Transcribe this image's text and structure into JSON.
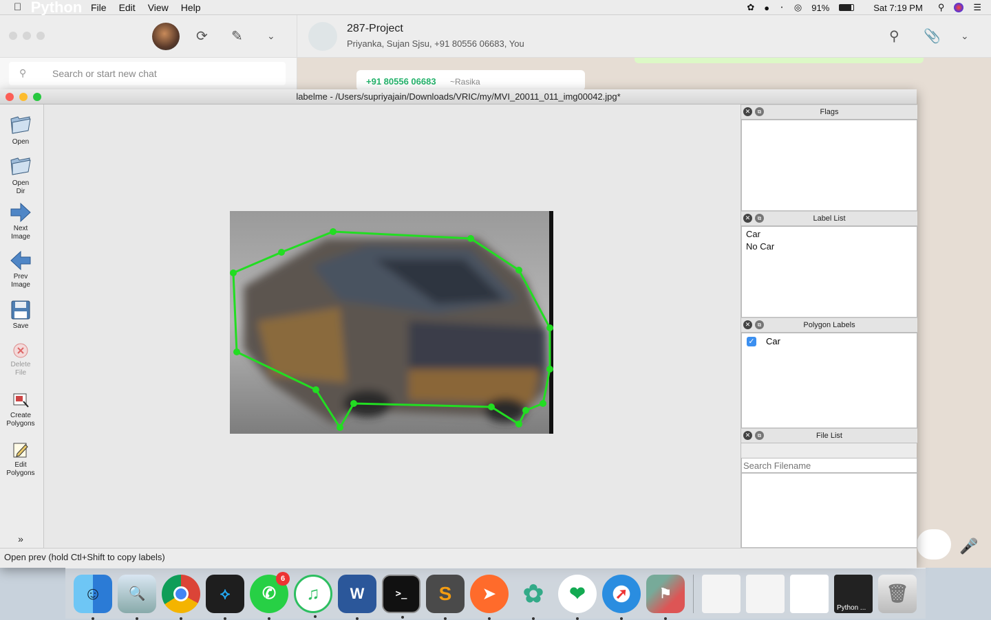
{
  "menubar": {
    "app_name": "Python",
    "items": [
      "File",
      "Edit",
      "View",
      "Help"
    ],
    "battery": "91%",
    "clock": "Sat 7:19 PM"
  },
  "whatsapp": {
    "search_placeholder": "Search or start new chat",
    "chat_title": "287-Project",
    "chat_members": "Priyanka, Sujan Sjsu, +91 80556 06683, You",
    "message_phone": "+91 80556 06683",
    "message_nick": "~Rasika"
  },
  "labelme": {
    "title": "labelme - /Users/supriyajain/Downloads/VRIC/my/MVI_20011_011_img00042.jpg*",
    "tools": {
      "open": "Open",
      "open_dir_1": "Open",
      "open_dir_2": "Dir",
      "next_1": "Next",
      "next_2": "Image",
      "prev_1": "Prev",
      "prev_2": "Image",
      "save": "Save",
      "delete_1": "Delete",
      "delete_2": "File",
      "create_1": "Create",
      "create_2": "Polygons",
      "edit_1": "Edit",
      "edit_2": "Polygons"
    },
    "docks": {
      "flags": "Flags",
      "label_list": "Label List",
      "polygon_labels": "Polygon Labels",
      "file_list": "File List"
    },
    "label_list_items": [
      "Car",
      "No Car"
    ],
    "polygon_label_items": [
      {
        "label": "Car",
        "checked": true
      }
    ],
    "file_search_placeholder": "Search Filename",
    "status": "Open prev (hold Ctl+Shift to copy labels)",
    "polygon_color": "#22dd22"
  },
  "dock": {
    "whatsapp_badge": "6",
    "python_label": "Python ..."
  }
}
